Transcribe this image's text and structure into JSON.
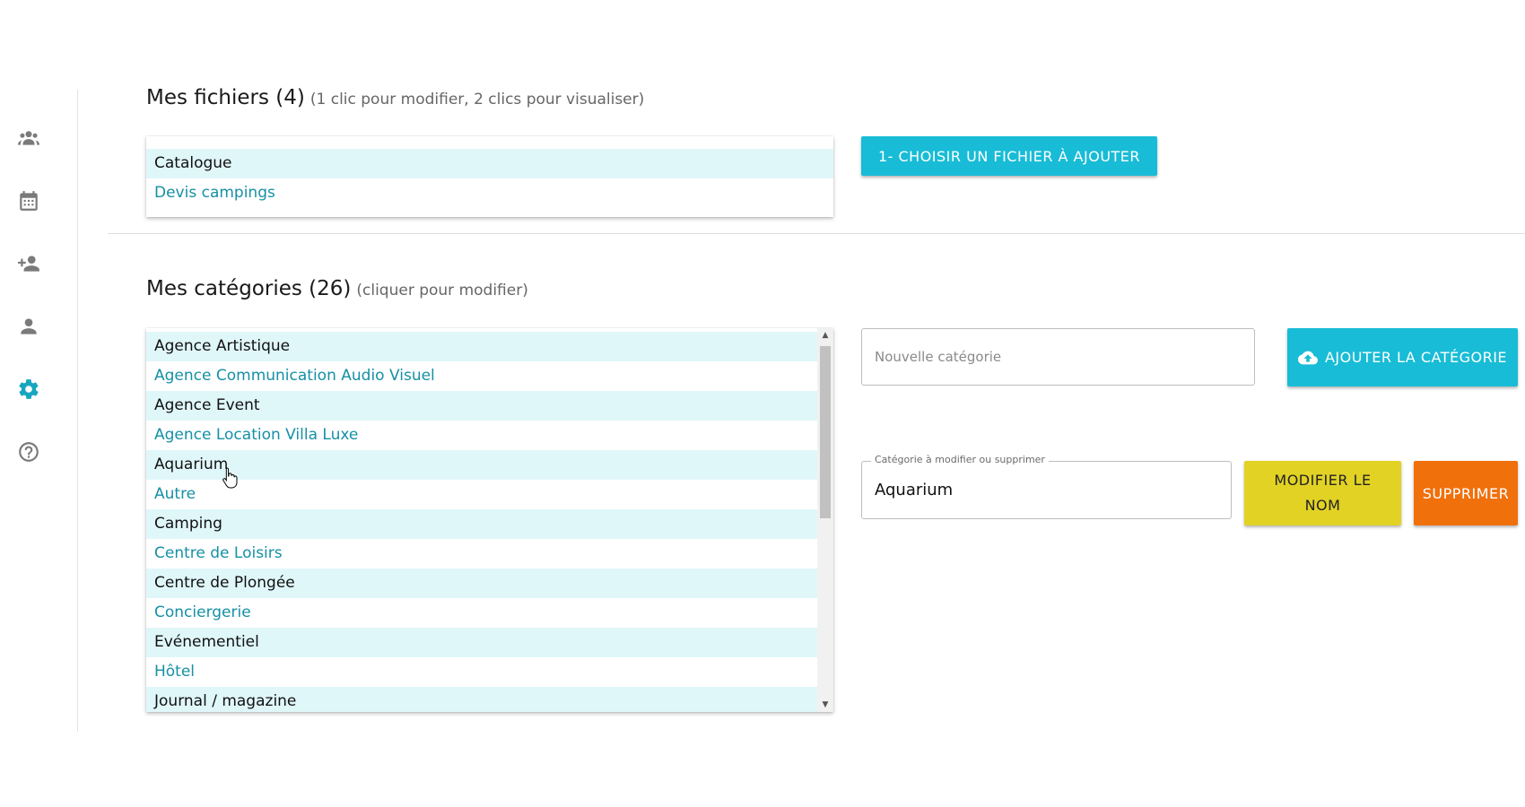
{
  "sidebar": {
    "icons": [
      {
        "name": "groups-icon",
        "active": false
      },
      {
        "name": "calendar-icon",
        "active": false
      },
      {
        "name": "add-person-icon",
        "active": false
      },
      {
        "name": "person-icon",
        "active": false
      },
      {
        "name": "settings-icon",
        "active": true
      },
      {
        "name": "help-icon",
        "active": false
      }
    ]
  },
  "files": {
    "title": "Mes fichiers (4)",
    "hint": "(1 clic pour modifier, 2 clics pour visualiser)",
    "items": [
      "Catalogue",
      "Devis campings"
    ],
    "choose_button": "1- Choisir un fichier à ajouter"
  },
  "categories": {
    "title": "Mes catégories (26)",
    "hint": "(cliquer pour modifier)",
    "items": [
      "Agence Artistique",
      "Agence Communication Audio Visuel",
      "Agence Event",
      "Agence Location Villa Luxe",
      "Aquarium",
      "Autre",
      "Camping",
      "Centre de Loisirs",
      "Centre de Plongée",
      "Conciergerie",
      "Evénementiel",
      "Hôtel",
      "Journal / magazine"
    ],
    "new_placeholder": "Nouvelle catégorie",
    "add_button": "Ajouter la catégorie",
    "edit_label": "Catégorie à modifier ou supprimer",
    "edit_value": "Aquarium",
    "rename_button": "Modifier le nom",
    "delete_button": "Supprimer"
  },
  "colors": {
    "accent": "#18bcd6",
    "row_highlight": "#e0f7fa",
    "link_text": "#1590a5",
    "rename": "#e2d224",
    "delete": "#f0700c"
  }
}
